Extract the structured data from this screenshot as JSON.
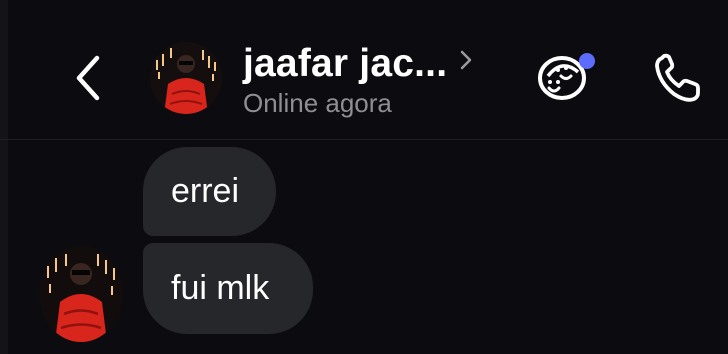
{
  "header": {
    "contact_name": "jaafar jac...",
    "status": "Online agora",
    "back_icon": "chevron-left-icon",
    "name_chevron_icon": "chevron-right-icon",
    "effects_icon": "chat-faces-icon",
    "call_icon": "phone-icon",
    "badge_color": "#5b6cff"
  },
  "messages": [
    {
      "text": "errei"
    },
    {
      "text": "fui mlk"
    }
  ],
  "colors": {
    "background": "#0c0c10",
    "bubble": "#26272b",
    "status_text": "#8e8e93"
  }
}
